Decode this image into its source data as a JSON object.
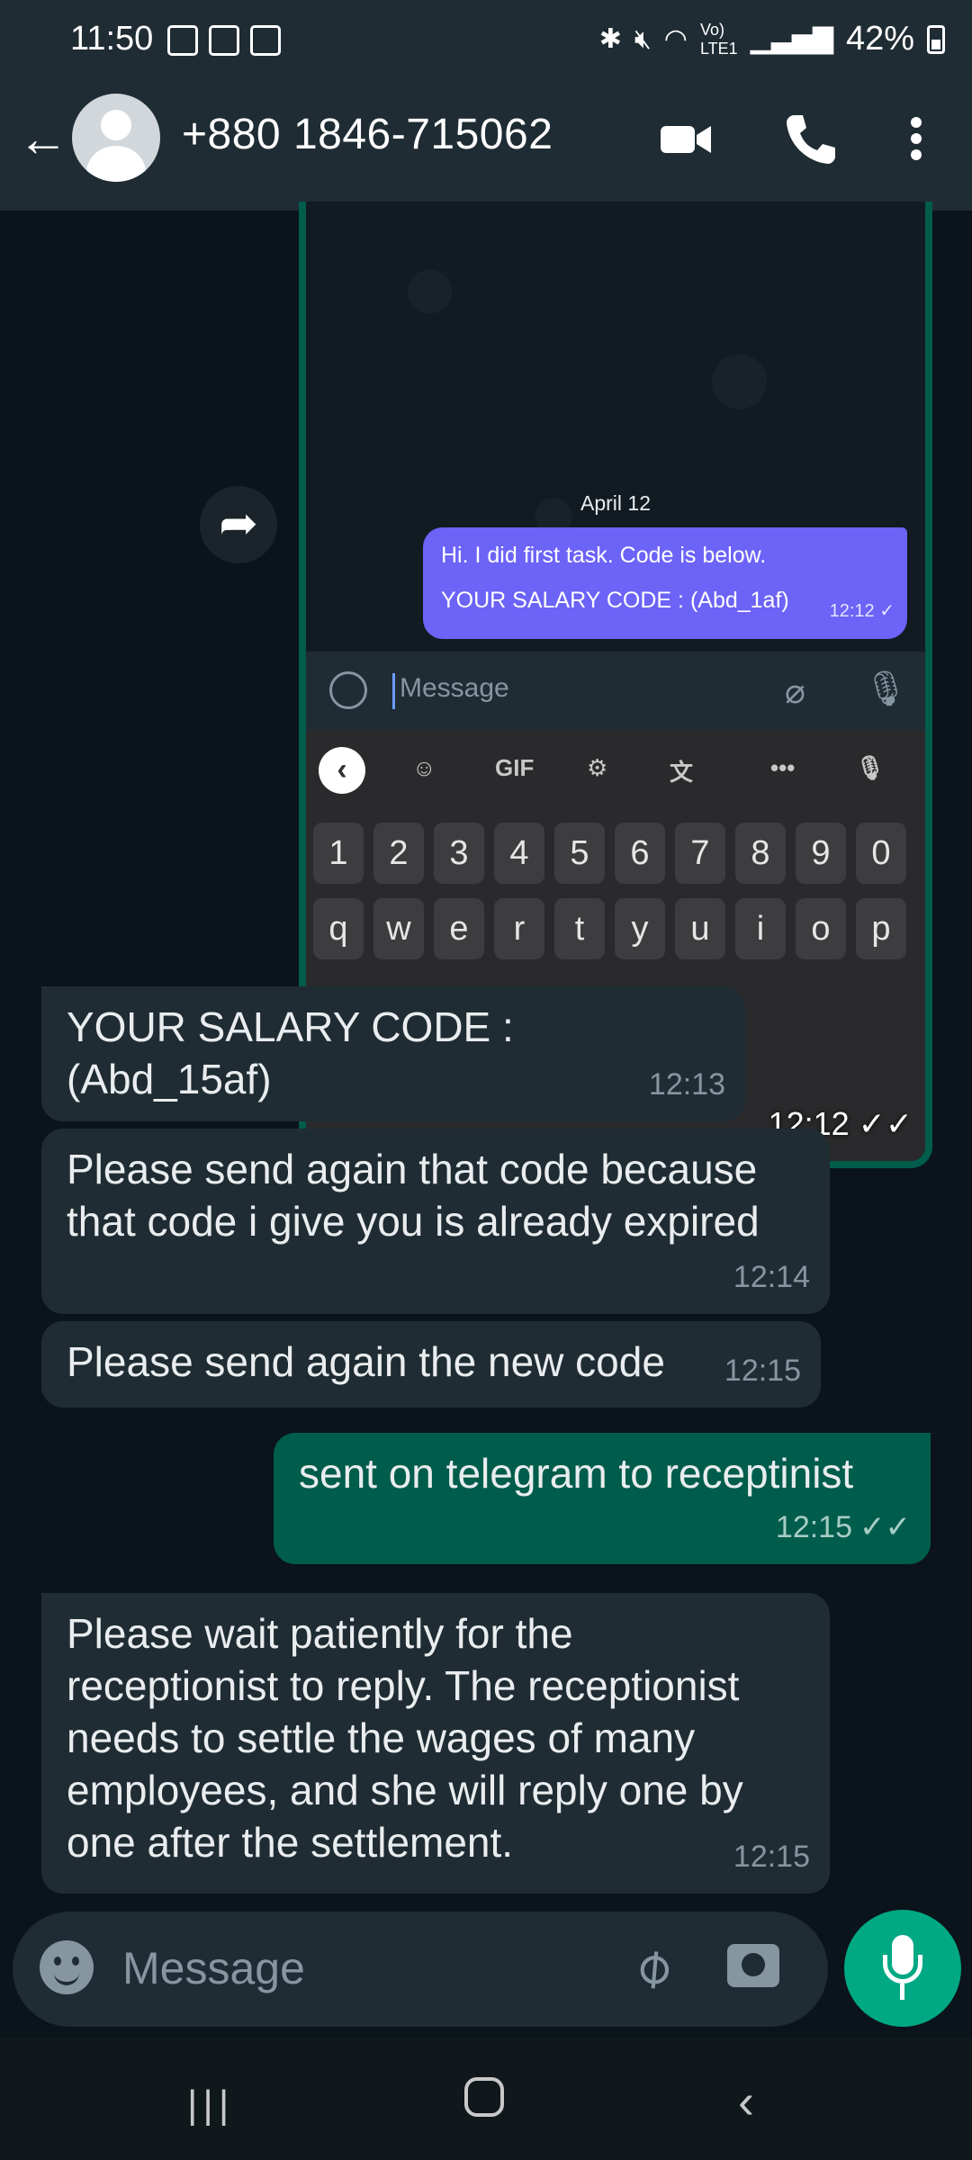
{
  "status_bar": {
    "time": "11:50",
    "battery": "42%",
    "icons": [
      "gallery-icon",
      "calendar-icon",
      "teams-icon",
      "bluetooth-icon",
      "mute-icon",
      "wifi-icon",
      "volte-icon",
      "signal-icon",
      "battery-icon"
    ]
  },
  "header": {
    "contact_name": "+880 1846-715062",
    "icons": [
      "back-arrow-icon",
      "avatar",
      "video-call-icon",
      "voice-call-icon",
      "more-vert-icon"
    ]
  },
  "forwarded_screenshot": {
    "date_label": "April 12",
    "message_line1": "Hi. I did first task. Code is below.",
    "message_line2": "YOUR SALARY CODE : (Abd_1af)",
    "message_time": "12:12",
    "input_placeholder": "Message",
    "keyboard_gif": "GIF",
    "keyboard_more": "•••",
    "number_row": [
      "1",
      "2",
      "3",
      "4",
      "5",
      "6",
      "7",
      "8",
      "9",
      "0"
    ],
    "letter_row": [
      "q",
      "w",
      "e",
      "r",
      "t",
      "y",
      "u",
      "i",
      "o",
      "p"
    ],
    "image_time": "12:12"
  },
  "messages": [
    {
      "direction": "in",
      "text": "YOUR SALARY CODE : (Abd_15af)",
      "time": "12:13"
    },
    {
      "direction": "in",
      "text": "Please send again that code because that code i give you is already expired",
      "time": "12:14"
    },
    {
      "direction": "in",
      "text": "Please send again the new code",
      "time": "12:15"
    },
    {
      "direction": "out",
      "text": "sent on telegram to receptinist",
      "time": "12:15",
      "status": "read"
    },
    {
      "direction": "in",
      "text": "Please wait patiently for the receptionist to reply. The receptionist needs to settle the wages of many employees, and she will reply one by one after the settlement.",
      "time": "12:15"
    }
  ],
  "composer": {
    "placeholder": "Message"
  },
  "colors": {
    "header_bg": "#1f2c34",
    "chat_bg": "#0b141a",
    "incoming_bubble": "#202c33",
    "outgoing_bubble": "#005c4b",
    "accent": "#00a884"
  }
}
